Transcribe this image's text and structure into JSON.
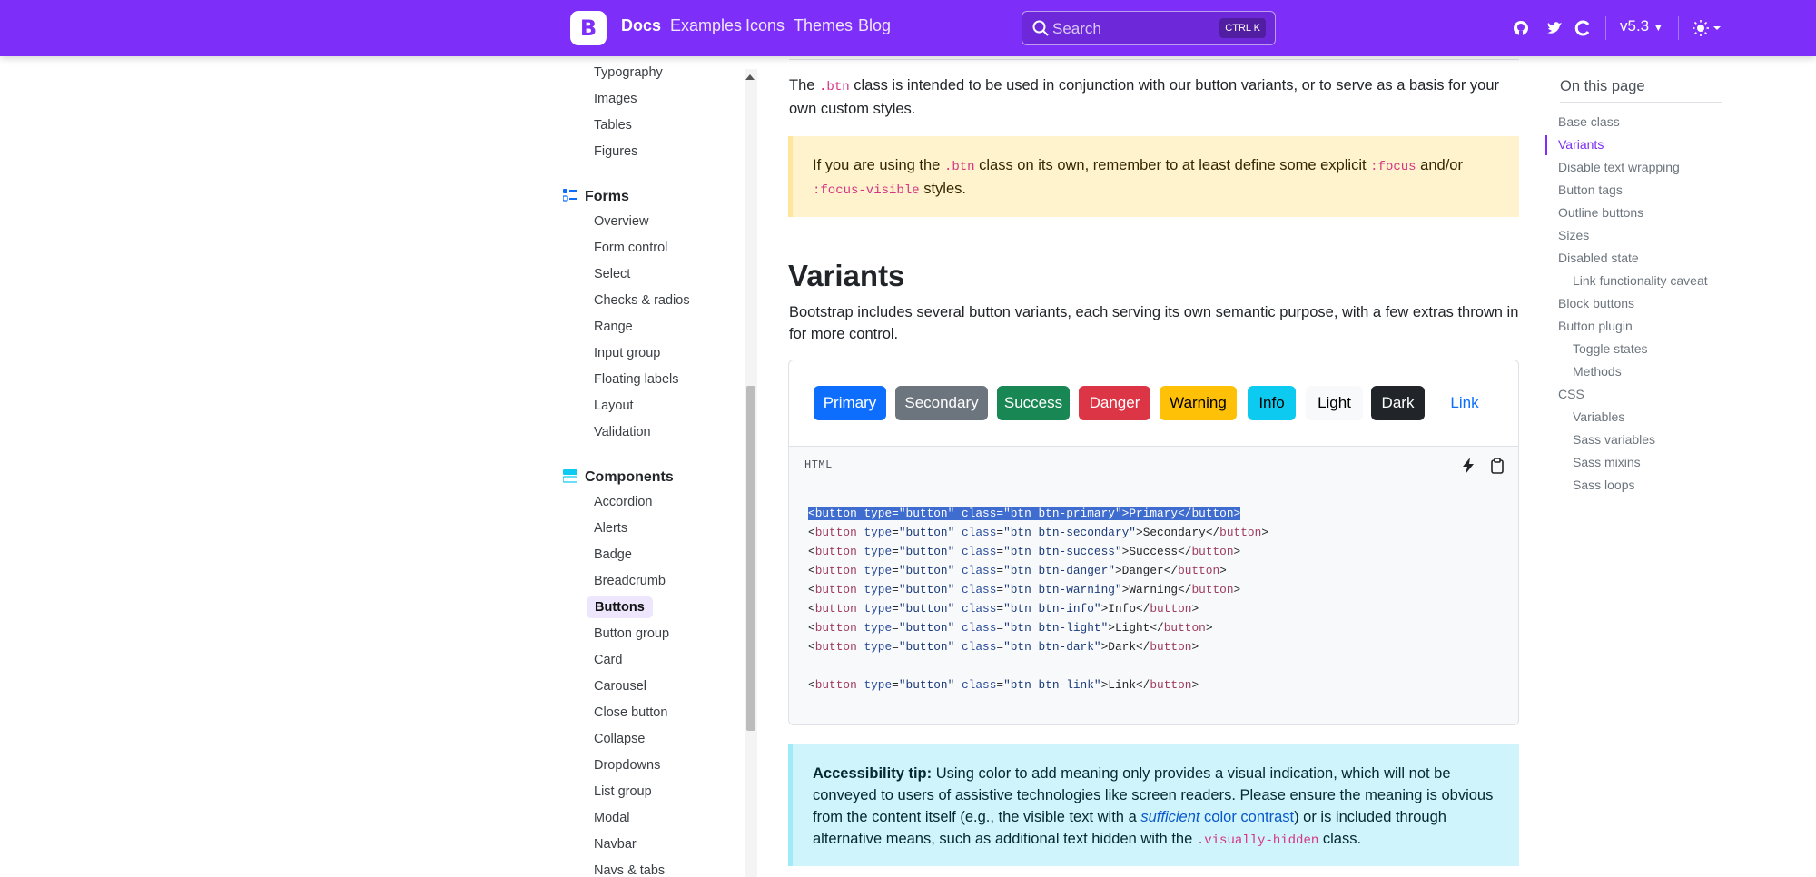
{
  "navbar": {
    "brand": "B",
    "links": [
      "Docs",
      "Examples",
      "Icons",
      "Themes",
      "Blog"
    ],
    "search_placeholder": "Search",
    "search_shortcut": "CTRL K",
    "version": "v5.3"
  },
  "sidebar": {
    "content_items": [
      "Typography",
      "Images",
      "Tables",
      "Figures"
    ],
    "forms_heading": "Forms",
    "forms_items": [
      "Overview",
      "Form control",
      "Select",
      "Checks & radios",
      "Range",
      "Input group",
      "Floating labels",
      "Layout",
      "Validation"
    ],
    "components_heading": "Components",
    "components_items": [
      "Accordion",
      "Alerts",
      "Badge",
      "Breadcrumb",
      "Buttons",
      "Button group",
      "Card",
      "Carousel",
      "Close button",
      "Collapse",
      "Dropdowns",
      "List group",
      "Modal",
      "Navbar",
      "Navs & tabs"
    ]
  },
  "main": {
    "intro_1": "The ",
    "intro_code": ".btn",
    "intro_2": " class is intended to be used in conjunction with our button variants, or to serve as a basis for your own custom styles.",
    "warn_1": "If you are using the ",
    "warn_code1": ".btn",
    "warn_2": " class on its own, remember to at least define some explicit ",
    "warn_code2": ":focus",
    "warn_3": " and/or ",
    "warn_code3": ":focus-visible",
    "warn_4": " styles.",
    "heading": "Variants",
    "variants_desc": "Bootstrap includes several button variants, each serving its own semantic purpose, with a few extras thrown in for more control.",
    "buttons": [
      "Primary",
      "Secondary",
      "Success",
      "Danger",
      "Warning",
      "Info",
      "Light",
      "Dark",
      "Link"
    ],
    "code_lang": "HTML",
    "code_lines": [
      {
        "cls": "btn btn-primary",
        "label": "Primary"
      },
      {
        "cls": "btn btn-secondary",
        "label": "Secondary"
      },
      {
        "cls": "btn btn-success",
        "label": "Success"
      },
      {
        "cls": "btn btn-danger",
        "label": "Danger"
      },
      {
        "cls": "btn btn-warning",
        "label": "Warning"
      },
      {
        "cls": "btn btn-info",
        "label": "Info"
      },
      {
        "cls": "btn btn-light",
        "label": "Light"
      },
      {
        "cls": "btn btn-dark",
        "label": "Dark"
      },
      {
        "cls": "btn btn-link",
        "label": "Link"
      }
    ],
    "code_tag_open": "<",
    "code_tag_name": "button",
    "code_attr_type": "type",
    "code_eq": "=",
    "code_val_type": "\"button\"",
    "code_attr_class": "class",
    "code_close_tag": "</",
    "code_gt": ">",
    "a11y_label": "Accessibility tip:",
    "a11y_1": " Using color to add meaning only provides a visual indication, which will not be conveyed to users of assistive technologies like screen readers. Please ensure the meaning is obvious from the content itself (e.g., the visible text with a ",
    "a11y_link_em": "sufficient",
    "a11y_link_rest": " color contrast",
    "a11y_2": ") or is included through alternative means, such as additional text hidden with the ",
    "a11y_code": ".visually-hidden",
    "a11y_3": " class."
  },
  "toc": {
    "title": "On this page",
    "items": [
      {
        "label": "Base class",
        "indent": false
      },
      {
        "label": "Variants",
        "indent": false
      },
      {
        "label": "Disable text wrapping",
        "indent": false
      },
      {
        "label": "Button tags",
        "indent": false
      },
      {
        "label": "Outline buttons",
        "indent": false
      },
      {
        "label": "Sizes",
        "indent": false
      },
      {
        "label": "Disabled state",
        "indent": false
      },
      {
        "label": "Link functionality caveat",
        "indent": true
      },
      {
        "label": "Block buttons",
        "indent": false
      },
      {
        "label": "Button plugin",
        "indent": false
      },
      {
        "label": "Toggle states",
        "indent": true
      },
      {
        "label": "Methods",
        "indent": true
      },
      {
        "label": "CSS",
        "indent": false
      },
      {
        "label": "Variables",
        "indent": true
      },
      {
        "label": "Sass variables",
        "indent": true
      },
      {
        "label": "Sass mixins",
        "indent": true
      },
      {
        "label": "Sass loops",
        "indent": true
      }
    ]
  },
  "colors": {
    "brand": "#7d2ef8",
    "primary": "#0d6efd",
    "secondary": "#6c757d",
    "success": "#198754",
    "danger": "#dc3545",
    "warning": "#ffc107",
    "info": "#0dcaf0",
    "light": "#f8f9fa",
    "dark": "#212529"
  }
}
